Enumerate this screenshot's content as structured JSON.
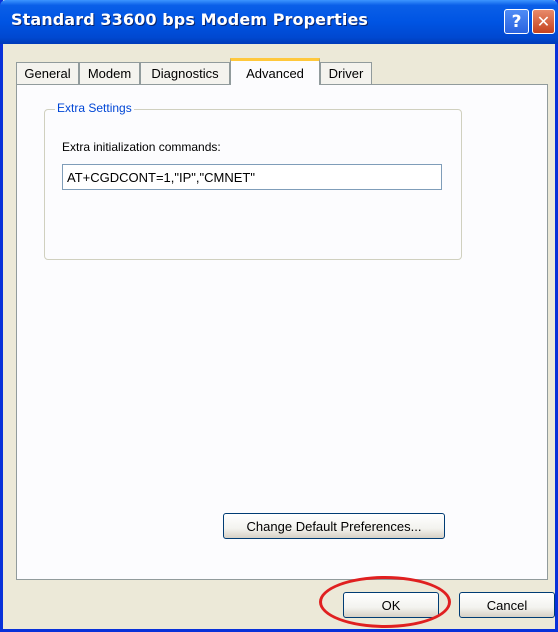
{
  "window": {
    "title": "Standard 33600 bps Modem Properties",
    "help_glyph": "?",
    "close_glyph": "✕"
  },
  "tabs": [
    {
      "label": "General",
      "active": false
    },
    {
      "label": "Modem",
      "active": false
    },
    {
      "label": "Diagnostics",
      "active": false
    },
    {
      "label": "Advanced",
      "active": true
    },
    {
      "label": "Driver",
      "active": false
    }
  ],
  "extra_settings": {
    "group_label": "Extra Settings",
    "field_label": "Extra initialization commands:",
    "field_value": "AT+CGDCONT=1,\"IP\",\"CMNET\""
  },
  "buttons": {
    "change_defaults": "Change Default Preferences...",
    "ok": "OK",
    "cancel": "Cancel"
  },
  "colors": {
    "highlight": "#e02020",
    "titlebar": "#0054e3",
    "active_tab_accent": "#ffc83c"
  }
}
